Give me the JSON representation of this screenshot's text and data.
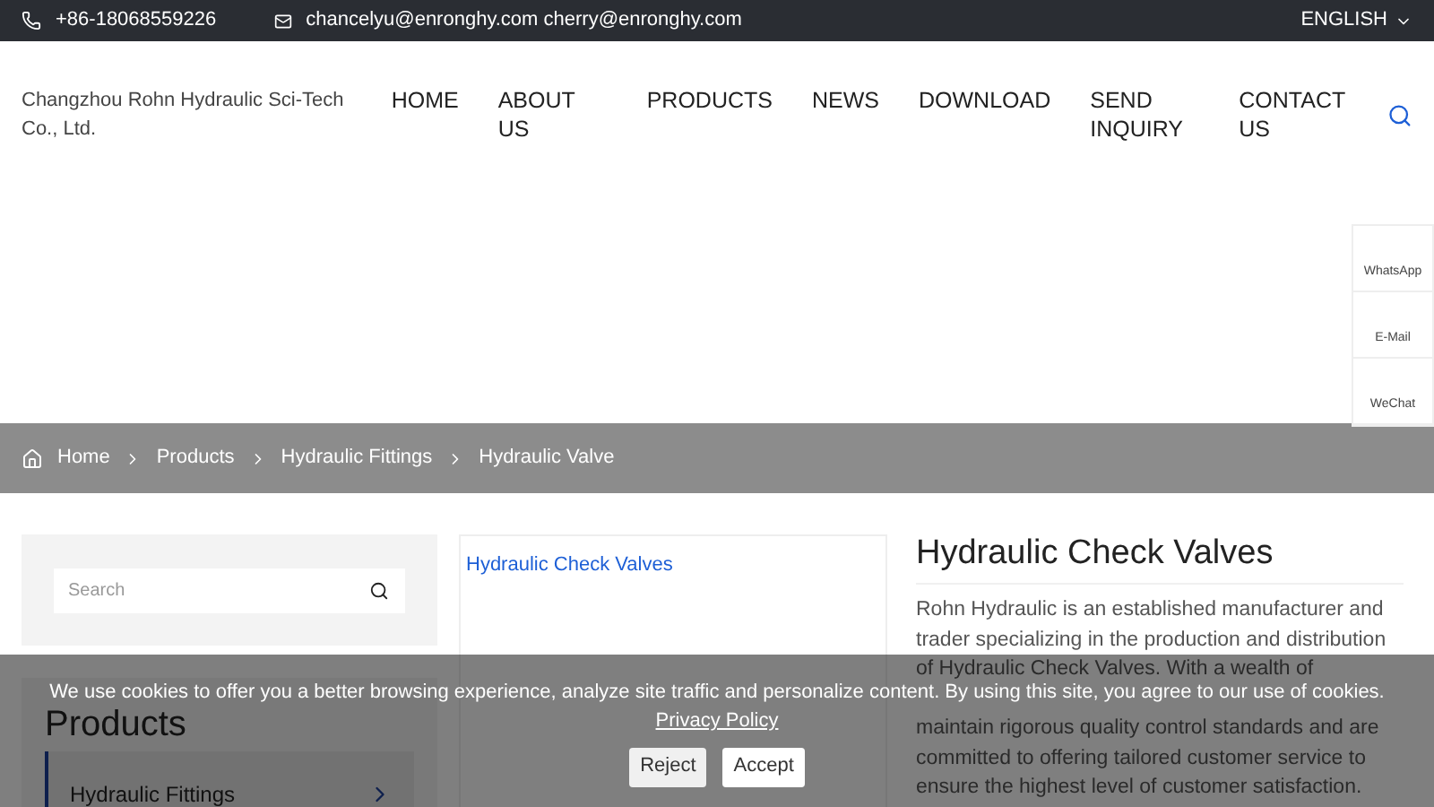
{
  "top_bar": {
    "phone": "+86-18068559226",
    "email": "chancelyu@enronghy.com cherry@enronghy.com",
    "language": "ENGLISH"
  },
  "header": {
    "company": "Changzhou Rohn Hydraulic Sci-Tech Co., Ltd.",
    "nav": [
      {
        "label": "HOME"
      },
      {
        "label": "ABOUT US"
      },
      {
        "label": "PRODUCTS"
      },
      {
        "label": "NEWS"
      },
      {
        "label": "DOWNLOAD"
      },
      {
        "label": "SEND INQUIRY"
      },
      {
        "label": "CONTACT US"
      }
    ]
  },
  "side_contacts": [
    {
      "label": "WhatsApp"
    },
    {
      "label": "E-Mail"
    },
    {
      "label": "WeChat"
    }
  ],
  "breadcrumb": [
    {
      "label": "Home"
    },
    {
      "label": "Products"
    },
    {
      "label": "Hydraulic Fittings"
    },
    {
      "label": "Hydraulic Valve"
    }
  ],
  "sidebar": {
    "search": {
      "placeholder": "Search"
    },
    "title": "Products",
    "items": [
      {
        "label": "Hydraulic Fittings",
        "selected": true
      }
    ]
  },
  "gallery": {
    "caption": "Hydraulic Check Valves"
  },
  "product": {
    "title": "Hydraulic Check Valves",
    "description": "Rohn Hydraulic is an established manufacturer and trader specializing in the production and distribution of Hydraulic Check Valves. With a wealth of",
    "description_continued": "maintain rigorous quality control standards and are committed to offering tailored customer service to ensure the highest level of customer satisfaction."
  },
  "cookie_banner": {
    "message": "We use cookies to offer you a better browsing experience, analyze site traffic and personalize content. By using this site, you agree to our use of cookies.",
    "link": "Privacy Policy",
    "buttons": [
      "Reject",
      "Accept"
    ]
  }
}
